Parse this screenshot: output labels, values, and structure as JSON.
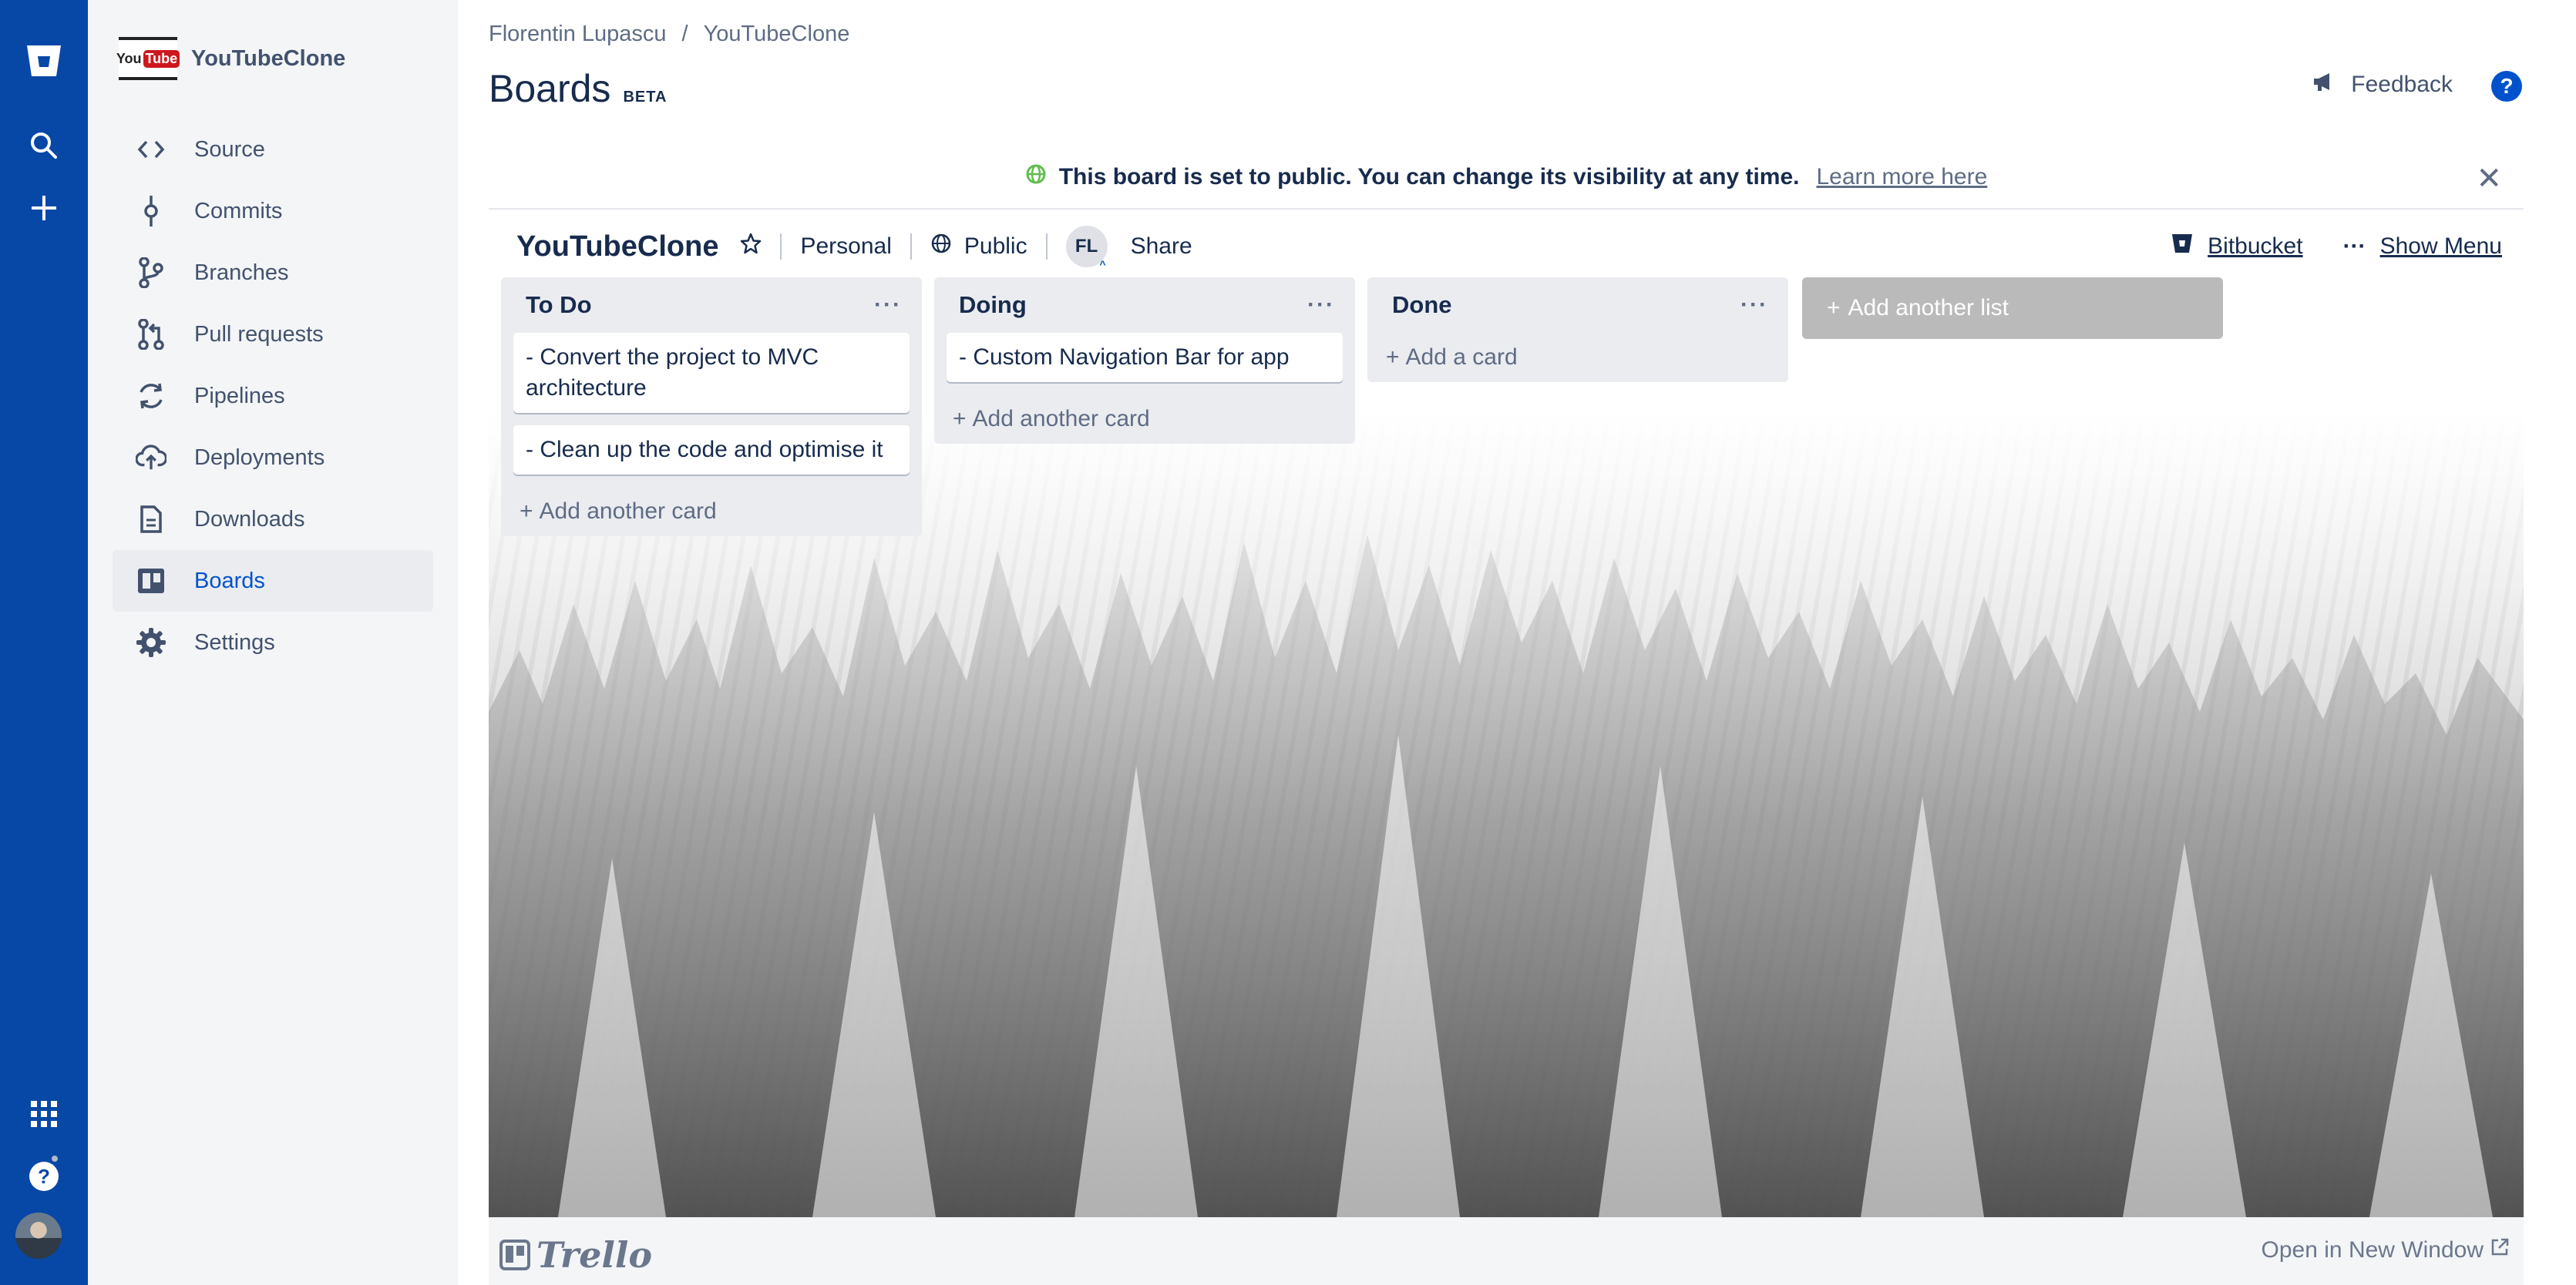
{
  "global_nav": {
    "icons": [
      "bitbucket-logo-icon",
      "search-icon",
      "create-icon",
      "app-switcher-icon",
      "help-icon",
      "user-avatar"
    ]
  },
  "project": {
    "logo_text_left": "You",
    "logo_text_right": "Tube",
    "name": "YouTubeClone"
  },
  "sidebar": {
    "items": [
      {
        "label": "Source",
        "icon": "source-code-icon"
      },
      {
        "label": "Commits",
        "icon": "commit-icon"
      },
      {
        "label": "Branches",
        "icon": "branch-icon"
      },
      {
        "label": "Pull requests",
        "icon": "pull-request-icon"
      },
      {
        "label": "Pipelines",
        "icon": "pipelines-icon"
      },
      {
        "label": "Deployments",
        "icon": "deployments-icon"
      },
      {
        "label": "Downloads",
        "icon": "downloads-icon"
      },
      {
        "label": "Boards",
        "icon": "boards-icon",
        "active": true
      },
      {
        "label": "Settings",
        "icon": "settings-icon"
      }
    ]
  },
  "header": {
    "breadcrumb": [
      "Florentin Lupascu",
      "YouTubeClone"
    ],
    "breadcrumb_sep": "/",
    "title": "Boards",
    "badge": "BETA",
    "feedback_label": "Feedback",
    "help_label": "?"
  },
  "notice": {
    "text": "This board is set to public. You can change its visibility at any time.",
    "link": "Learn more here",
    "close": "✕"
  },
  "board": {
    "name": "YouTubeClone",
    "team": "Personal",
    "visibility": "Public",
    "member_initials": "FL",
    "share_label": "Share",
    "bitbucket_label": "Bitbucket",
    "menu_dots": "···",
    "menu_label": "Show Menu",
    "lists": [
      {
        "title": "To Do",
        "cards": [
          "- Convert the project to MVC architecture",
          "- Clean up the code and optimise it"
        ],
        "add_label": "Add another card"
      },
      {
        "title": "Doing",
        "cards": [
          "- Custom Navigation Bar for app"
        ],
        "add_label": "Add another card"
      },
      {
        "title": "Done",
        "cards": [],
        "add_label": "Add a card"
      }
    ],
    "list_menu": "···",
    "add_list_label": "Add another list"
  },
  "footer": {
    "brand": "Trello",
    "open_window_label": "Open in New Window"
  },
  "colors": {
    "global_nav": "#0747a6",
    "sidebar_bg": "#f4f5f7",
    "active_item": "#0052cc",
    "public_globe": "#61bd4f"
  }
}
